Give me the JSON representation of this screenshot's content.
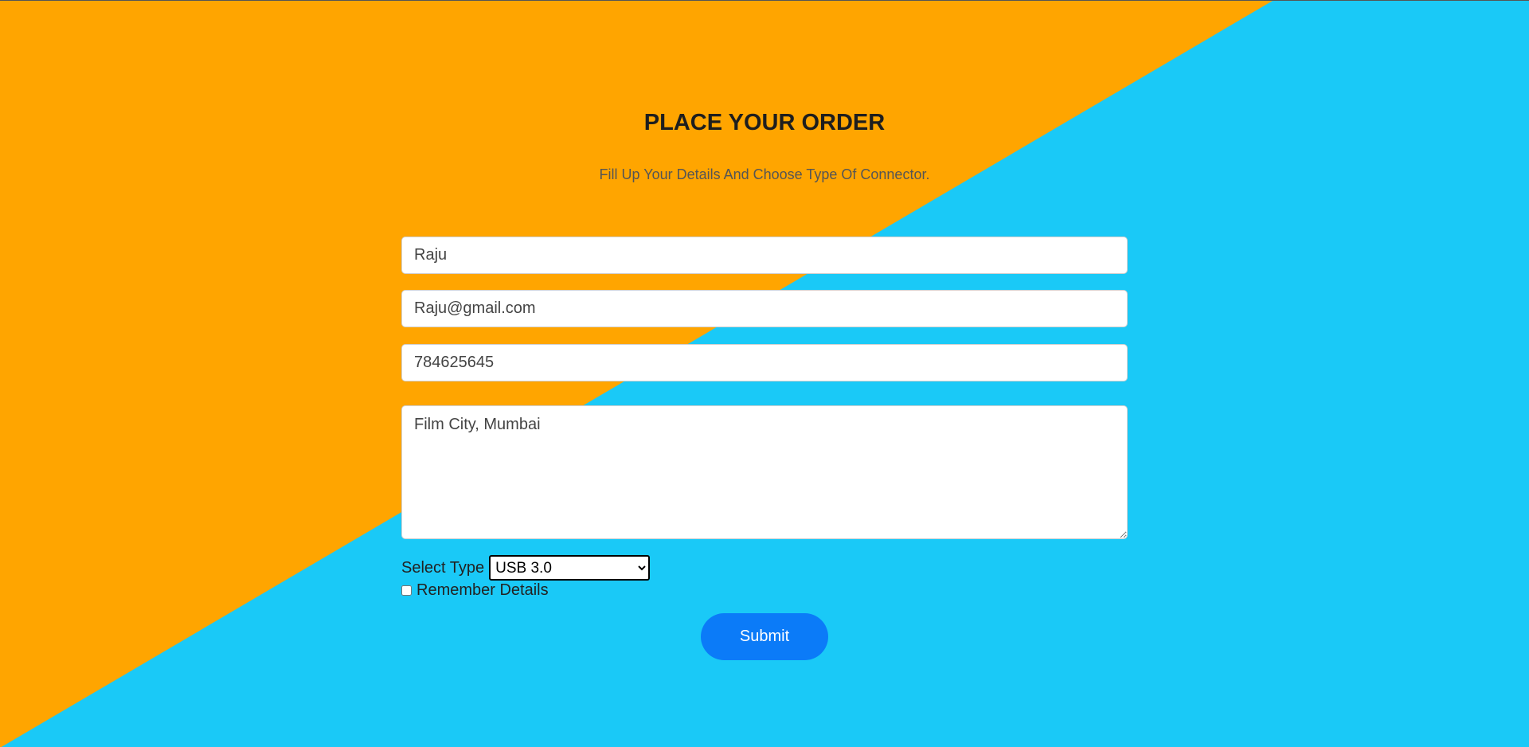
{
  "header": {
    "title": "PLACE YOUR ORDER",
    "subtitle": "Fill Up Your Details And Choose Type Of Connector."
  },
  "form": {
    "name_value": "Raju",
    "email_value": "Raju@gmail.com",
    "phone_value": "784625645",
    "address_value": "Film City, Mumbai",
    "select_label": "Select Type",
    "select_value": "USB 3.0",
    "remember_label": "Remember Details",
    "remember_checked": false,
    "submit_label": "Submit"
  },
  "colors": {
    "background_orange": "#ffa500",
    "background_blue": "#1ac9f7",
    "submit_button": "#0b7bf8"
  },
  "icons": {
    "select_arrow": "chevron-down-icon",
    "textarea_resize": "resize-handle-icon"
  }
}
